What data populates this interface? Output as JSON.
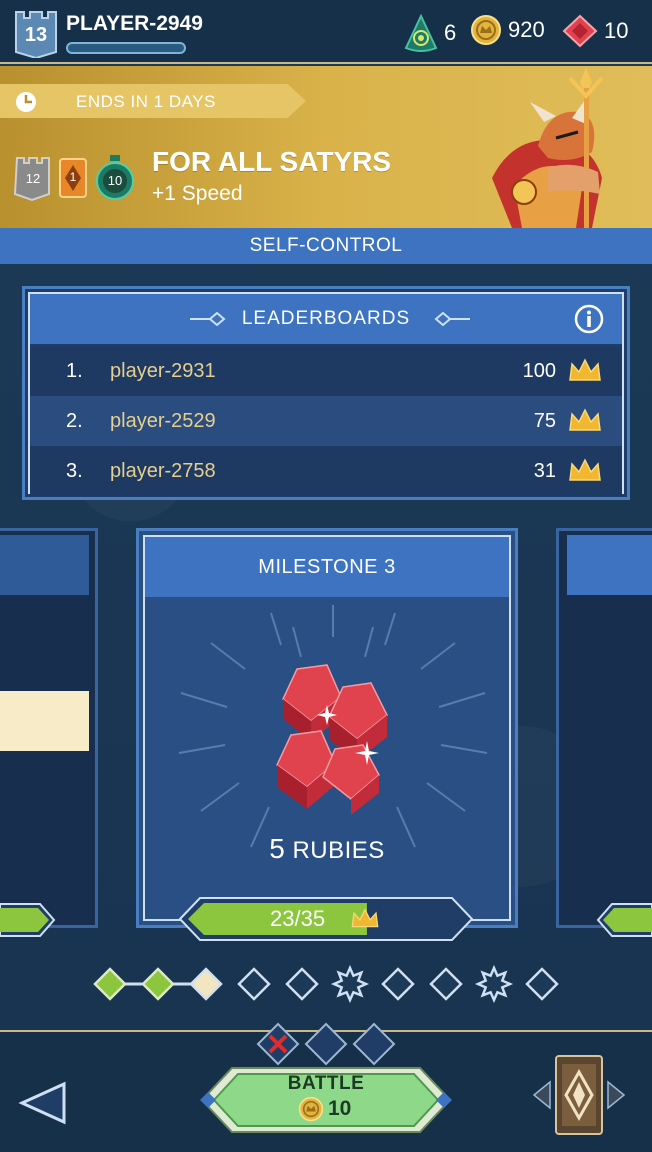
{
  "player": {
    "level": "13",
    "name": "PLAYER-2949",
    "xp_fraction": 0.0
  },
  "currencies": {
    "mana": "6",
    "gold": "920",
    "rubies": "10"
  },
  "event": {
    "timer_label": "ENDS IN 1 DAYS",
    "tower_level": "12",
    "card_level": "1",
    "timer_badge": "10",
    "title": "FOR ALL SATYRS",
    "subtitle": "+1 Speed",
    "section_label": "SELF-CONTROL"
  },
  "leaderboard": {
    "title": "LEADERBOARDS",
    "rows": [
      {
        "rank": "1.",
        "name": "player-2931",
        "score": "100"
      },
      {
        "rank": "2.",
        "name": "player-2529",
        "score": "75"
      },
      {
        "rank": "3.",
        "name": "player-2758",
        "score": "31"
      }
    ]
  },
  "milestone": {
    "title": "MILESTONE 3",
    "reward_count": "5",
    "reward_label": "RUBIES",
    "progress_text": "23/35",
    "progress_fraction": 0.657
  },
  "milestone_dots": [
    {
      "state": "complete",
      "shape": "diamond"
    },
    {
      "state": "complete",
      "shape": "diamond"
    },
    {
      "state": "current",
      "shape": "diamond"
    },
    {
      "state": "locked",
      "shape": "diamond"
    },
    {
      "state": "locked",
      "shape": "diamond"
    },
    {
      "state": "locked",
      "shape": "star"
    },
    {
      "state": "locked",
      "shape": "diamond"
    },
    {
      "state": "locked",
      "shape": "diamond"
    },
    {
      "state": "locked",
      "shape": "star"
    },
    {
      "state": "locked",
      "shape": "diamond"
    }
  ],
  "bottom": {
    "battle_label": "BATTLE",
    "battle_cost": "10"
  },
  "colors": {
    "background": "#1a3550",
    "panel_blue": "#3d73c0",
    "gold": "#e0bd5a",
    "name_gold": "#e6cf8c",
    "progress_green": "#8cc63f",
    "ruby_red": "#e0424e"
  }
}
